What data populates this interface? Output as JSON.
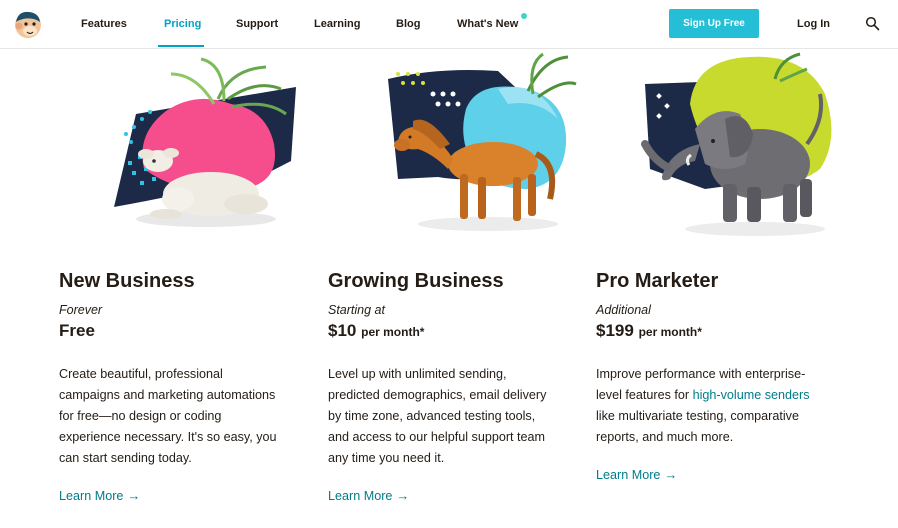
{
  "header": {
    "nav": [
      {
        "label": "Features"
      },
      {
        "label": "Pricing"
      },
      {
        "label": "Support"
      },
      {
        "label": "Learning"
      },
      {
        "label": "Blog"
      },
      {
        "label": "What's New"
      }
    ],
    "active_nav": "Pricing",
    "signup_label": "Sign Up Free",
    "login_label": "Log In",
    "icons": [
      "freddie-logo-icon",
      "search-icon"
    ]
  },
  "plans": [
    {
      "name": "New Business",
      "term": "Forever",
      "price": "Free",
      "price_suffix": "",
      "description_lines": [
        "Create beautiful, professional",
        "campaigns and marketing automations",
        "for free—no design or coding",
        "experience necessary. It's so easy, you",
        "can start sending today."
      ],
      "learn_more": "Learn More",
      "illustration": "lamb-figurine"
    },
    {
      "name": "Growing Business",
      "term": "Starting at",
      "price": "$10",
      "price_suffix": "per month*",
      "description_lines": [
        "Level up with unlimited sending,",
        "predicted demographics, email delivery",
        "by time zone, advanced testing tools,",
        "and access to our helpful support team",
        "any time you need it."
      ],
      "learn_more": "Learn More",
      "illustration": "horse-figurine"
    },
    {
      "name": "Pro Marketer",
      "term": "Additional",
      "price": "$199",
      "price_suffix": "per month*",
      "description_parts": {
        "line1": "Improve performance with enterprise-",
        "line2_prefix": "level features for ",
        "line2_link": "high-volume senders",
        "line3": "like multivariate testing, comparative",
        "line4": "reports, and much more."
      },
      "learn_more": "Learn More",
      "illustration": "elephant-figurine"
    }
  ],
  "colors": {
    "brand_teal": "#24bfd6",
    "link": "#007c89",
    "active_nav": "#00a3c4",
    "text": "#241c15"
  }
}
